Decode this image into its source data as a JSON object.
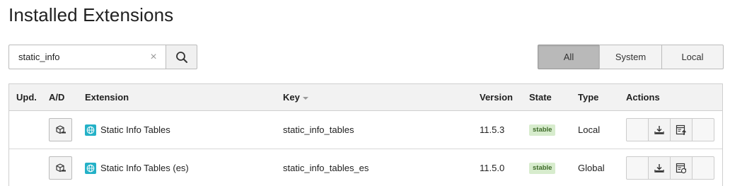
{
  "page": {
    "title": "Installed Extensions"
  },
  "search": {
    "value": "static_info",
    "placeholder": "",
    "clear_icon": "close-icon",
    "button_icon": "search-icon"
  },
  "filters": {
    "active": "All",
    "items": [
      {
        "label": "All"
      },
      {
        "label": "System"
      },
      {
        "label": "Local"
      }
    ]
  },
  "table": {
    "headers": {
      "upd": "Upd.",
      "ad": "A/D",
      "extension": "Extension",
      "key": "Key",
      "version": "Version",
      "state": "State",
      "type": "Type",
      "actions": "Actions"
    },
    "sorted_by": "Key",
    "rows": [
      {
        "name": "Static Info Tables",
        "key": "static_info_tables",
        "version": "11.5.3",
        "state": "stable",
        "type": "Local",
        "ad_icon": "package-deactivate-icon",
        "ext_icon": "globe-icon",
        "action_icons": [
          "download-icon",
          "upload-icon"
        ]
      },
      {
        "name": "Static Info Tables (es)",
        "key": "static_info_tables_es",
        "version": "11.5.0",
        "state": "stable",
        "type": "Global",
        "ad_icon": "package-deactivate-icon",
        "ext_icon": "globe-icon",
        "action_icons": [
          "download-icon",
          "reload-database-icon"
        ]
      }
    ]
  },
  "colors": {
    "accent_ext_icon": "#24b1c7",
    "badge_bg": "#d7eccd",
    "badge_text": "#3f6b2a",
    "active_filter": "#b9b9b9"
  }
}
